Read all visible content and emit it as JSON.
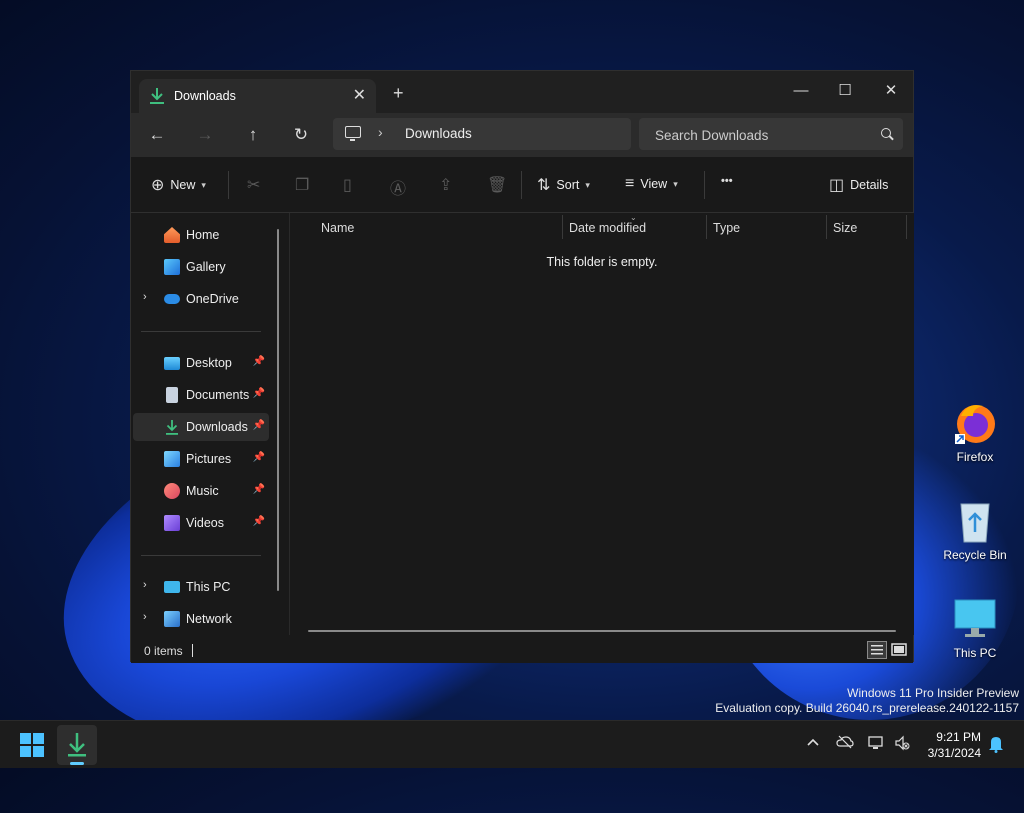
{
  "window": {
    "tab_title": "Downloads",
    "tab_close": "✕",
    "new_tab": "+",
    "controls": {
      "minimize": "—",
      "maximize": "☐",
      "close": "✕"
    }
  },
  "navbar": {
    "back": "←",
    "forward": "→",
    "up": "↑",
    "refresh": "↻",
    "breadcrumb_sep": "›",
    "breadcrumb": "Downloads",
    "search_placeholder": "Search Downloads"
  },
  "toolbar": {
    "new_label": "New",
    "sort_label": "Sort",
    "view_label": "View",
    "more_label": "•••",
    "details_label": "Details"
  },
  "sidebar": {
    "items": [
      {
        "label": "Home",
        "icon": "home-icon"
      },
      {
        "label": "Gallery",
        "icon": "gallery-icon"
      },
      {
        "label": "OneDrive",
        "icon": "onedrive-icon"
      },
      {
        "label": "Desktop",
        "icon": "desktop-icon"
      },
      {
        "label": "Documents",
        "icon": "documents-icon"
      },
      {
        "label": "Downloads",
        "icon": "downloads-icon"
      },
      {
        "label": "Pictures",
        "icon": "pictures-icon"
      },
      {
        "label": "Music",
        "icon": "music-icon"
      },
      {
        "label": "Videos",
        "icon": "videos-icon"
      },
      {
        "label": "This PC",
        "icon": "this-pc-icon"
      },
      {
        "label": "Network",
        "icon": "network-icon"
      }
    ],
    "expander": "›",
    "pin": "📌"
  },
  "content": {
    "columns": [
      "Name",
      "Date modified",
      "Type",
      "Size"
    ],
    "empty_message": "This folder is empty."
  },
  "status": {
    "items_count": "0 items"
  },
  "desktop": {
    "icons": [
      {
        "label": "Firefox"
      },
      {
        "label": "Recycle Bin"
      },
      {
        "label": "This PC"
      }
    ],
    "watermark_line1": "Windows 11 Pro Insider Preview",
    "watermark_line2": "Evaluation copy. Build 26040.rs_prerelease.240122-1157"
  },
  "taskbar": {
    "time": "9:21 PM",
    "date": "3/31/2024",
    "tray_chevron": "^"
  },
  "colors": {
    "accent": "#60cdff",
    "window_bg": "#191919",
    "download_green": "#3fbf7f"
  }
}
